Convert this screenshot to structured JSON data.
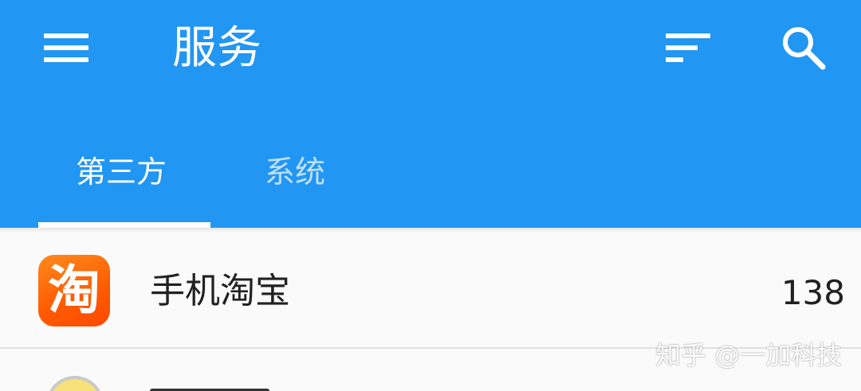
{
  "appbar": {
    "title": "服务",
    "menu_icon": "hamburger-menu-icon",
    "sort_icon": "sort-icon",
    "search_icon": "search-icon",
    "background_color": "#2196F3"
  },
  "tabs": [
    {
      "label": "第三方",
      "active": true
    },
    {
      "label": "系统",
      "active": false
    }
  ],
  "list": {
    "items": [
      {
        "icon_text": "淘",
        "icon_color": "#FF5A00",
        "name": "手机淘宝",
        "count": "138"
      }
    ]
  },
  "watermark": "知乎 @一加科技"
}
